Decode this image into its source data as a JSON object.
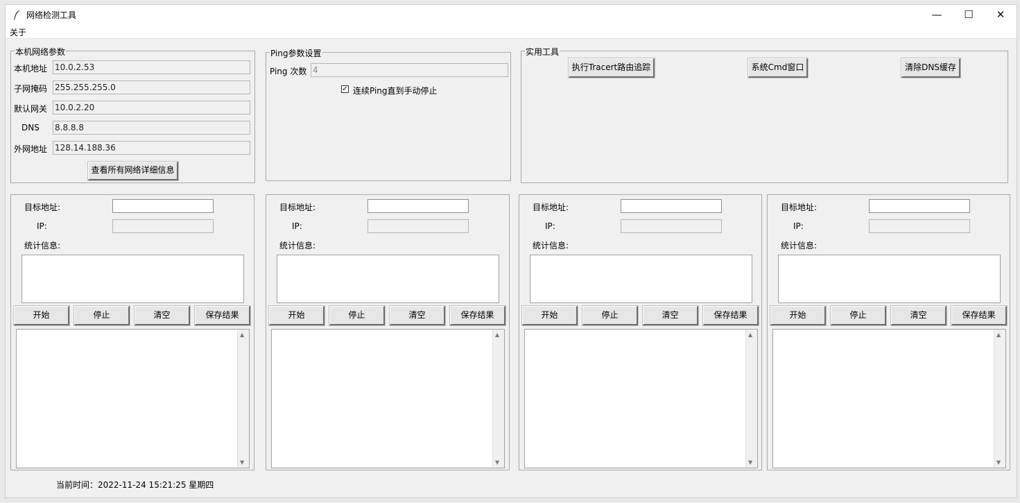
{
  "window": {
    "title": "网络检测工具",
    "controls": {
      "minimize": "—",
      "maximize": "☐",
      "close": "✕"
    }
  },
  "menu": {
    "items": [
      "关于"
    ]
  },
  "local_params": {
    "legend": "本机网络参数",
    "fields": [
      {
        "label": "本机地址",
        "value": "10.0.2.53"
      },
      {
        "label": "子网掩码",
        "value": "255.255.255.0"
      },
      {
        "label": "默认网关",
        "value": "10.0.2.20"
      },
      {
        "label": "DNS",
        "value": "8.8.8.8"
      },
      {
        "label": "外网地址",
        "value": "128.14.188.36"
      }
    ],
    "details_button": "查看所有网络详细信息"
  },
  "ping_settings": {
    "legend": "Ping参数设置",
    "count_label": "Ping 次数",
    "count_value": "4",
    "continuous_label": "连续Ping直到手动停止",
    "continuous_checked": true
  },
  "tools": {
    "legend": "实用工具",
    "buttons": [
      "执行Tracert路由追踪",
      "系统Cmd窗口",
      "清除DNS缓存"
    ]
  },
  "ping_panel_labels": {
    "target": "目标地址:",
    "ip": "IP:",
    "stats": "统计信息:",
    "start": "开始",
    "stop": "停止",
    "clear": "清空",
    "save": "保存结果"
  },
  "status": {
    "time_text": "当前时间：2022-11-24 15:21:25  星期四"
  }
}
